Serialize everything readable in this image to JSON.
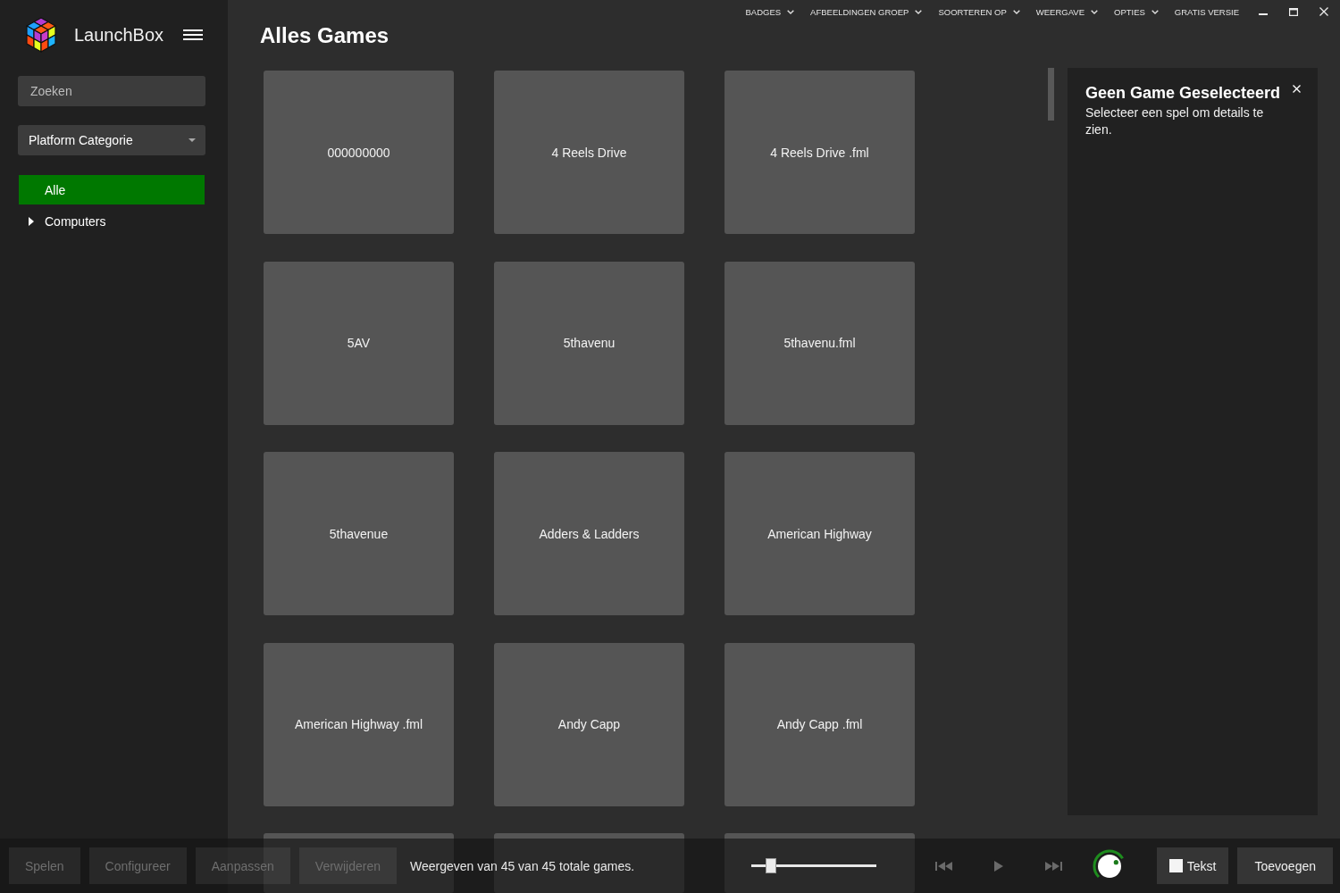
{
  "window": {
    "menu": [
      {
        "label": "BADGES",
        "kind": "dropdown"
      },
      {
        "label": "AFBEELDINGEN GROEP",
        "kind": "dropdown"
      },
      {
        "label": "SOORTEREN OP",
        "kind": "dropdown"
      },
      {
        "label": "WEERGAVE",
        "kind": "dropdown"
      },
      {
        "label": "OPTIES",
        "kind": "dropdown"
      },
      {
        "label": "GRATIS VERSIE",
        "kind": "link"
      }
    ]
  },
  "sidebar": {
    "app_name": "LaunchBox",
    "search": {
      "placeholder": "Zoeken"
    },
    "category_dropdown": {
      "value": "Platform Categorie"
    },
    "tree": [
      {
        "label": "Alle",
        "selected": true
      },
      {
        "label": "Computers",
        "selected": false,
        "expanded": false
      }
    ]
  },
  "main": {
    "title": "Alles Games",
    "games": [
      {
        "title": "000000000",
        "selected": false
      },
      {
        "title": "4 Reels Drive",
        "selected": false
      },
      {
        "title": "4 Reels Drive .fml",
        "selected": false
      },
      {
        "title": "5AV",
        "selected": false
      },
      {
        "title": "5thavenu",
        "selected": false
      },
      {
        "title": "5thavenu.fml",
        "selected": false
      },
      {
        "title": "5thavenue",
        "selected": false
      },
      {
        "title": "Adders & Ladders",
        "selected": false
      },
      {
        "title": "American Highway",
        "selected": false
      },
      {
        "title": "American Highway .fml",
        "selected": false
      },
      {
        "title": "Andy Capp",
        "selected": false
      },
      {
        "title": "Andy Capp .fml",
        "selected": false
      },
      {
        "selected": false
      },
      {
        "selected": false
      },
      {
        "selected": false
      }
    ]
  },
  "details_panel": {
    "title": "Geen Game Geselecteerd",
    "message": "Selecteer een spel om details te zien."
  },
  "bottom_bar": {
    "buttons": [
      {
        "label": "Spelen",
        "disabled": true
      },
      {
        "label": "Configureer",
        "disabled": true
      },
      {
        "label": "Aanpassen",
        "disabled": true
      },
      {
        "label": "Verwijderen",
        "disabled": true
      }
    ],
    "status": "Weergeven van 45 van 45 totale games.",
    "zoom_slider": {
      "level": 0.16
    },
    "media": [
      {
        "kind": "previous",
        "disabled": true
      },
      {
        "kind": "play",
        "disabled": true
      },
      {
        "kind": "next",
        "disabled": true
      }
    ],
    "volume_knob": {
      "level": 0.72
    },
    "text_toggle": {
      "label": "Tekst",
      "checked": false
    },
    "add_button": {
      "label": "Toevoegen"
    }
  }
}
